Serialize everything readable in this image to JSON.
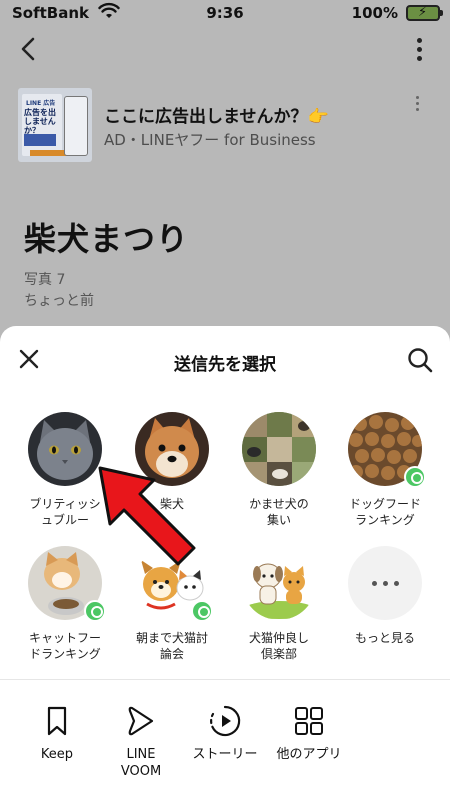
{
  "status_bar": {
    "carrier": "SoftBank",
    "time": "9:36",
    "battery": "100%"
  },
  "background_page": {
    "ad": {
      "title": "ここに広告出しませんか？👉",
      "subtitle": "AD・LINEヤフー for Business",
      "thumb_brand": "LINE 広告",
      "thumb_headline": "広告を出しませんか？"
    },
    "title": "柴犬まつり",
    "photo_count": "写真 7",
    "time": "ちょっと前"
  },
  "share_sheet": {
    "title": "送信先を選択",
    "contacts": [
      {
        "name": "ブリティッシ\nュブルー",
        "icon": "gray-cat-photo",
        "badge": false
      },
      {
        "name": "柴犬",
        "icon": "shiba-dog-photo",
        "badge": false
      },
      {
        "name": "かませ犬の\n集い",
        "icon": "dog-collage-photo",
        "badge": false
      },
      {
        "name": "ドッグフード\nランキング",
        "icon": "dog-food-photo",
        "badge": true
      },
      {
        "name": "キャットフー\nドランキング",
        "icon": "cat-eating-photo",
        "badge": true
      },
      {
        "name": "朝まで犬猫討\n論会",
        "icon": "dog-cat-illustration",
        "badge": true
      },
      {
        "name": "犬猫仲良し\n倶楽部",
        "icon": "dog-cat-friends-illustration",
        "badge": false
      },
      {
        "name": "もっと見る",
        "icon": "more-dots-icon",
        "badge": false
      }
    ],
    "actions": [
      {
        "label": "Keep",
        "icon": "bookmark-icon"
      },
      {
        "label": "LINE\nVOOM",
        "icon": "voom-play-icon"
      },
      {
        "label": "ストーリー",
        "icon": "story-play-icon"
      },
      {
        "label": "他のアプリ",
        "icon": "grid-apps-icon"
      }
    ]
  },
  "colors": {
    "badge_green": "#4cc764",
    "arrow_red": "#e8161b",
    "dim_overlay": "#b8b8b8"
  }
}
